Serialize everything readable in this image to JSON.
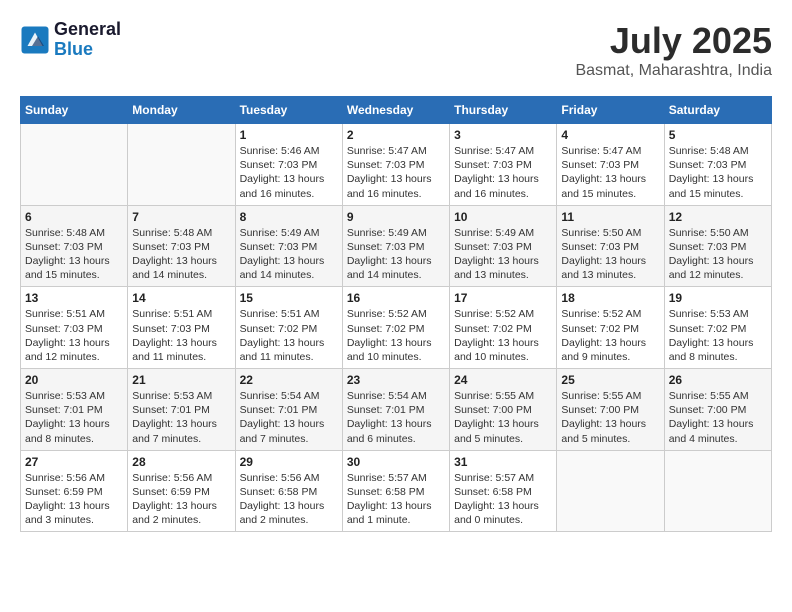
{
  "header": {
    "logo_general": "General",
    "logo_blue": "Blue",
    "title": "July 2025",
    "subtitle": "Basmat, Maharashtra, India"
  },
  "calendar": {
    "weekdays": [
      "Sunday",
      "Monday",
      "Tuesday",
      "Wednesday",
      "Thursday",
      "Friday",
      "Saturday"
    ],
    "weeks": [
      [
        {
          "day": "",
          "info": ""
        },
        {
          "day": "",
          "info": ""
        },
        {
          "day": "1",
          "info": "Sunrise: 5:46 AM\nSunset: 7:03 PM\nDaylight: 13 hours\nand 16 minutes."
        },
        {
          "day": "2",
          "info": "Sunrise: 5:47 AM\nSunset: 7:03 PM\nDaylight: 13 hours\nand 16 minutes."
        },
        {
          "day": "3",
          "info": "Sunrise: 5:47 AM\nSunset: 7:03 PM\nDaylight: 13 hours\nand 16 minutes."
        },
        {
          "day": "4",
          "info": "Sunrise: 5:47 AM\nSunset: 7:03 PM\nDaylight: 13 hours\nand 15 minutes."
        },
        {
          "day": "5",
          "info": "Sunrise: 5:48 AM\nSunset: 7:03 PM\nDaylight: 13 hours\nand 15 minutes."
        }
      ],
      [
        {
          "day": "6",
          "info": "Sunrise: 5:48 AM\nSunset: 7:03 PM\nDaylight: 13 hours\nand 15 minutes."
        },
        {
          "day": "7",
          "info": "Sunrise: 5:48 AM\nSunset: 7:03 PM\nDaylight: 13 hours\nand 14 minutes."
        },
        {
          "day": "8",
          "info": "Sunrise: 5:49 AM\nSunset: 7:03 PM\nDaylight: 13 hours\nand 14 minutes."
        },
        {
          "day": "9",
          "info": "Sunrise: 5:49 AM\nSunset: 7:03 PM\nDaylight: 13 hours\nand 14 minutes."
        },
        {
          "day": "10",
          "info": "Sunrise: 5:49 AM\nSunset: 7:03 PM\nDaylight: 13 hours\nand 13 minutes."
        },
        {
          "day": "11",
          "info": "Sunrise: 5:50 AM\nSunset: 7:03 PM\nDaylight: 13 hours\nand 13 minutes."
        },
        {
          "day": "12",
          "info": "Sunrise: 5:50 AM\nSunset: 7:03 PM\nDaylight: 13 hours\nand 12 minutes."
        }
      ],
      [
        {
          "day": "13",
          "info": "Sunrise: 5:51 AM\nSunset: 7:03 PM\nDaylight: 13 hours\nand 12 minutes."
        },
        {
          "day": "14",
          "info": "Sunrise: 5:51 AM\nSunset: 7:03 PM\nDaylight: 13 hours\nand 11 minutes."
        },
        {
          "day": "15",
          "info": "Sunrise: 5:51 AM\nSunset: 7:02 PM\nDaylight: 13 hours\nand 11 minutes."
        },
        {
          "day": "16",
          "info": "Sunrise: 5:52 AM\nSunset: 7:02 PM\nDaylight: 13 hours\nand 10 minutes."
        },
        {
          "day": "17",
          "info": "Sunrise: 5:52 AM\nSunset: 7:02 PM\nDaylight: 13 hours\nand 10 minutes."
        },
        {
          "day": "18",
          "info": "Sunrise: 5:52 AM\nSunset: 7:02 PM\nDaylight: 13 hours\nand 9 minutes."
        },
        {
          "day": "19",
          "info": "Sunrise: 5:53 AM\nSunset: 7:02 PM\nDaylight: 13 hours\nand 8 minutes."
        }
      ],
      [
        {
          "day": "20",
          "info": "Sunrise: 5:53 AM\nSunset: 7:01 PM\nDaylight: 13 hours\nand 8 minutes."
        },
        {
          "day": "21",
          "info": "Sunrise: 5:53 AM\nSunset: 7:01 PM\nDaylight: 13 hours\nand 7 minutes."
        },
        {
          "day": "22",
          "info": "Sunrise: 5:54 AM\nSunset: 7:01 PM\nDaylight: 13 hours\nand 7 minutes."
        },
        {
          "day": "23",
          "info": "Sunrise: 5:54 AM\nSunset: 7:01 PM\nDaylight: 13 hours\nand 6 minutes."
        },
        {
          "day": "24",
          "info": "Sunrise: 5:55 AM\nSunset: 7:00 PM\nDaylight: 13 hours\nand 5 minutes."
        },
        {
          "day": "25",
          "info": "Sunrise: 5:55 AM\nSunset: 7:00 PM\nDaylight: 13 hours\nand 5 minutes."
        },
        {
          "day": "26",
          "info": "Sunrise: 5:55 AM\nSunset: 7:00 PM\nDaylight: 13 hours\nand 4 minutes."
        }
      ],
      [
        {
          "day": "27",
          "info": "Sunrise: 5:56 AM\nSunset: 6:59 PM\nDaylight: 13 hours\nand 3 minutes."
        },
        {
          "day": "28",
          "info": "Sunrise: 5:56 AM\nSunset: 6:59 PM\nDaylight: 13 hours\nand 2 minutes."
        },
        {
          "day": "29",
          "info": "Sunrise: 5:56 AM\nSunset: 6:58 PM\nDaylight: 13 hours\nand 2 minutes."
        },
        {
          "day": "30",
          "info": "Sunrise: 5:57 AM\nSunset: 6:58 PM\nDaylight: 13 hours\nand 1 minute."
        },
        {
          "day": "31",
          "info": "Sunrise: 5:57 AM\nSunset: 6:58 PM\nDaylight: 13 hours\nand 0 minutes."
        },
        {
          "day": "",
          "info": ""
        },
        {
          "day": "",
          "info": ""
        }
      ]
    ]
  }
}
